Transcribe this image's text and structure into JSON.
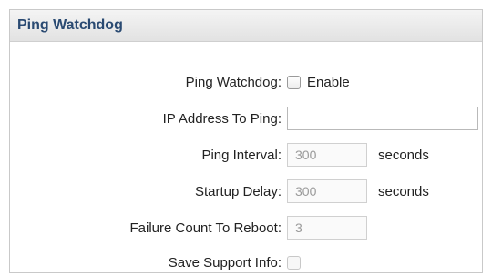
{
  "panel": {
    "title": "Ping Watchdog"
  },
  "fields": {
    "ping_watchdog": {
      "label": "Ping Watchdog:",
      "checkbox_label": "Enable",
      "checked": false
    },
    "ip_address": {
      "label": "IP Address To Ping:",
      "value": ""
    },
    "ping_interval": {
      "label": "Ping Interval:",
      "value": "300",
      "unit": "seconds"
    },
    "startup_delay": {
      "label": "Startup Delay:",
      "value": "300",
      "unit": "seconds"
    },
    "failure_count": {
      "label": "Failure Count To Reboot:",
      "value": "3"
    },
    "save_support": {
      "label": "Save Support Info:",
      "checked": false
    }
  },
  "colors": {
    "header_text": "#2a4a72",
    "disabled_text": "#9a9a9a"
  }
}
